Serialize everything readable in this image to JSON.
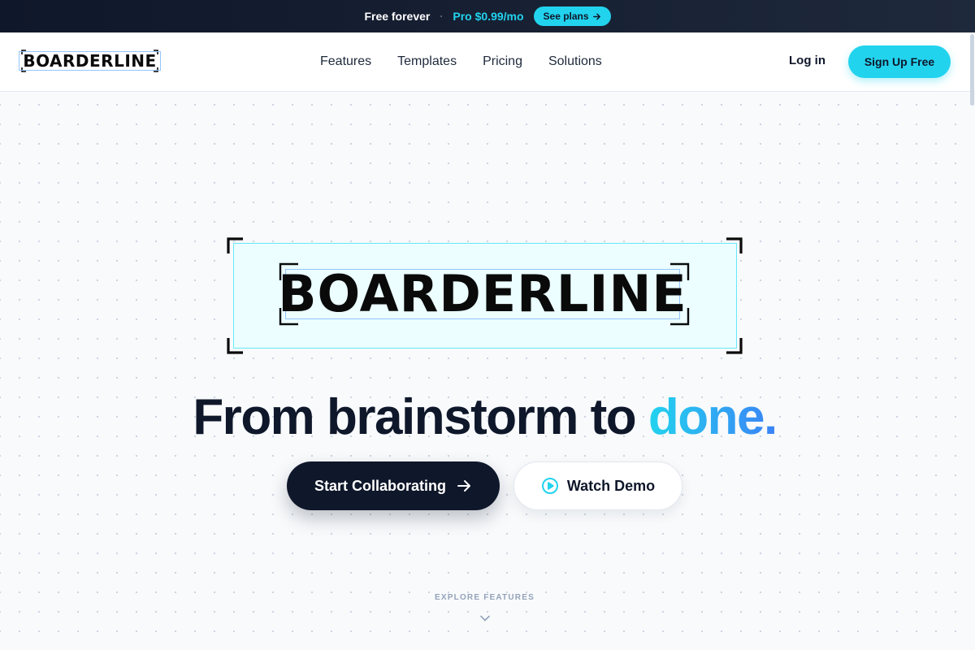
{
  "announcement": {
    "free_text": "Free forever",
    "separator": "·",
    "pro_text": "Pro $0.99/mo",
    "plans_label": "See plans"
  },
  "nav": {
    "brand": "BOARDERLINE",
    "links": [
      "Features",
      "Templates",
      "Pricing",
      "Solutions"
    ],
    "login": "Log in",
    "signup": "Sign Up Free"
  },
  "hero": {
    "logo_text": "BOARDERLINE",
    "headline_main": "From brainstorm to ",
    "headline_accent": "done.",
    "primary_cta": "Start Collaborating",
    "secondary_cta": "Watch Demo",
    "explore_label": "EXPLORE FEATURES"
  },
  "icons": {
    "plans_arrow": "arrow-right-icon",
    "cta_arrow": "arrow-right-icon",
    "demo_icon": "play-circle-icon",
    "explore_icon": "chevron-down-icon"
  },
  "colors": {
    "accent": "#22d3ee",
    "accent_gradient_end": "#3b82f6",
    "dark": "#0f172a",
    "logo_box_fill": "#ecfeff",
    "logo_box_border": "#67e8f9",
    "selection_border": "#93c5fd"
  }
}
